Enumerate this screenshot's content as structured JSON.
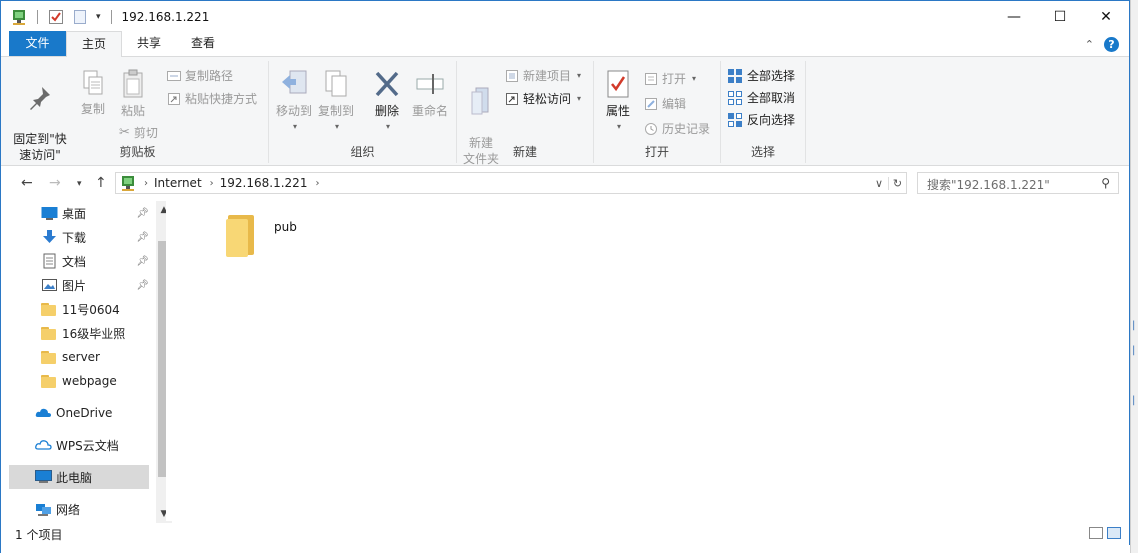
{
  "window": {
    "title": "192.168.1.221",
    "controls": {
      "minimize": "—",
      "maximize": "☐",
      "close": "✕"
    }
  },
  "ribbon_tabs": {
    "file": "文件",
    "home": "主页",
    "share": "共享",
    "view": "查看"
  },
  "ribbon": {
    "clipboard": {
      "label": "剪贴板",
      "pin": "固定到\"快\n速访问\"",
      "copy": "复制",
      "paste": "粘贴",
      "copy_path": "复制路径",
      "paste_shortcut": "粘贴快捷方式",
      "cut": "剪切"
    },
    "organize": {
      "label": "组织",
      "move_to": "移动到",
      "copy_to": "复制到",
      "delete": "删除",
      "rename": "重命名"
    },
    "new": {
      "label": "新建",
      "new_folder": "新建\n文件夹",
      "new_item": "新建项目",
      "easy_access": "轻松访问"
    },
    "open": {
      "label": "打开",
      "properties": "属性",
      "open": "打开",
      "edit": "编辑",
      "history": "历史记录"
    },
    "select": {
      "label": "选择",
      "select_all": "全部选择",
      "select_none": "全部取消",
      "invert": "反向选择"
    }
  },
  "address": {
    "crumbs": [
      "Internet",
      "192.168.1.221"
    ],
    "search_placeholder": "搜索\"192.168.1.221\""
  },
  "nav_pane": {
    "quick_access": [
      {
        "label": "桌面",
        "icon": "desktop-icon",
        "pinned": true
      },
      {
        "label": "下载",
        "icon": "download-icon",
        "pinned": true
      },
      {
        "label": "文档",
        "icon": "document-icon",
        "pinned": true
      },
      {
        "label": "图片",
        "icon": "pictures-icon",
        "pinned": true
      },
      {
        "label": "11号0604",
        "icon": "folder-icon",
        "pinned": false
      },
      {
        "label": "16级毕业照",
        "icon": "folder-icon",
        "pinned": false
      },
      {
        "label": "server",
        "icon": "folder-icon",
        "pinned": false
      },
      {
        "label": "webpage",
        "icon": "folder-icon",
        "pinned": false
      }
    ],
    "onedrive": "OneDrive",
    "wps": "WPS云文档",
    "this_pc": "此电脑",
    "network": "网络"
  },
  "content": {
    "items": [
      {
        "name": "pub",
        "icon": "folder-icon"
      }
    ]
  },
  "status": {
    "count": "1 个项目"
  },
  "colors": {
    "accent": "#1979ca",
    "folder": "#f8d775",
    "ribbon_bg": "#f5f6f7"
  }
}
